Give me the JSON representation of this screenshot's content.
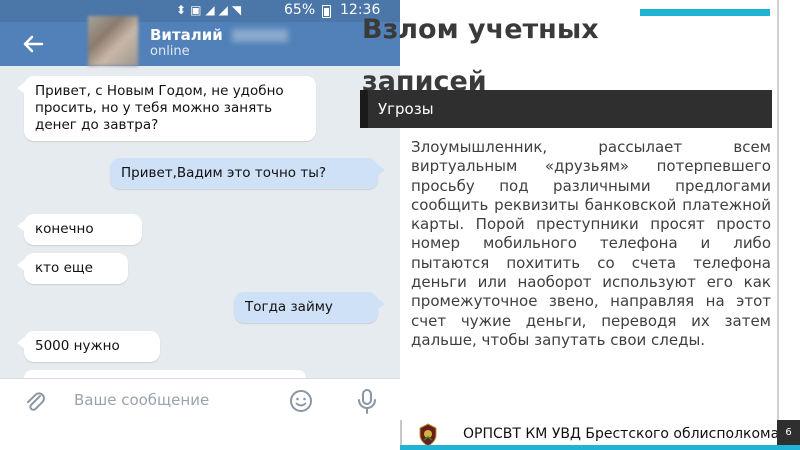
{
  "phone": {
    "status_bar": {
      "icons": [
        "usb-icon",
        "screenshot-icon",
        "signal-icon",
        "signal-icon",
        "wifi-icon"
      ],
      "battery": "65%",
      "time": "12:36"
    },
    "chat_header": {
      "contact_name": "Виталий",
      "contact_status": "online"
    },
    "messages": [
      {
        "direction": "in",
        "text": "Привет, с Новым Годом, не удобно просить, но у тебя можно занять денег до завтра?"
      },
      {
        "direction": "out",
        "text": "Привет,Вадим это точно ты?"
      },
      {
        "direction": "in",
        "text": "конечно"
      },
      {
        "direction": "in",
        "text": "кто еще"
      },
      {
        "direction": "out",
        "text": "Тогда займу"
      },
      {
        "direction": "in",
        "text": "5000 нужно"
      },
      {
        "direction": "in",
        "text": ""
      }
    ],
    "input": {
      "placeholder": "Ваше сообщение"
    },
    "colors": {
      "header": "#5181b8",
      "status_bar": "#4a76a8",
      "outgoing_bubble": "#cfe1f7",
      "chat_background": "#e6ebf0"
    }
  },
  "slide": {
    "title": "Взлом учетных записей",
    "section_label": "Угрозы",
    "body": "Злоумышленник, рассылает всем виртуальным «друзьям» потерпевшего просьбу под различными предлогами сообщить реквизиты банковской платежной карты. Порой преступники просят просто номер мобильного телефона и либо пытаются похитить со счета телефона деньги или наоборот используют его как промежуточное звено, направляя на этот счет чужие деньги, переводя их затем дальше, чтобы запутать свои следы.",
    "accent_color": "#1fb3d6"
  },
  "footer": {
    "organization": "ОРПСВТ КМ УВД Брестского облисполкома",
    "page_number": "6"
  }
}
